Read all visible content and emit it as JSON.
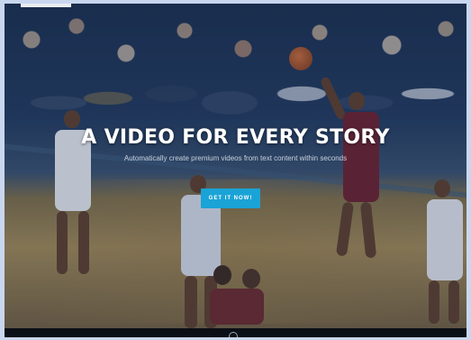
{
  "hero": {
    "headline": "A VIDEO FOR EVERY STORY",
    "subline": "Automatically create premium videos from text content within seconds",
    "cta_label": "GET IT NOW!"
  },
  "colors": {
    "accent": "#1aa3d6",
    "page_background": "#c9d7ee"
  },
  "icons": {
    "scroll": "scroll-down-icon"
  }
}
